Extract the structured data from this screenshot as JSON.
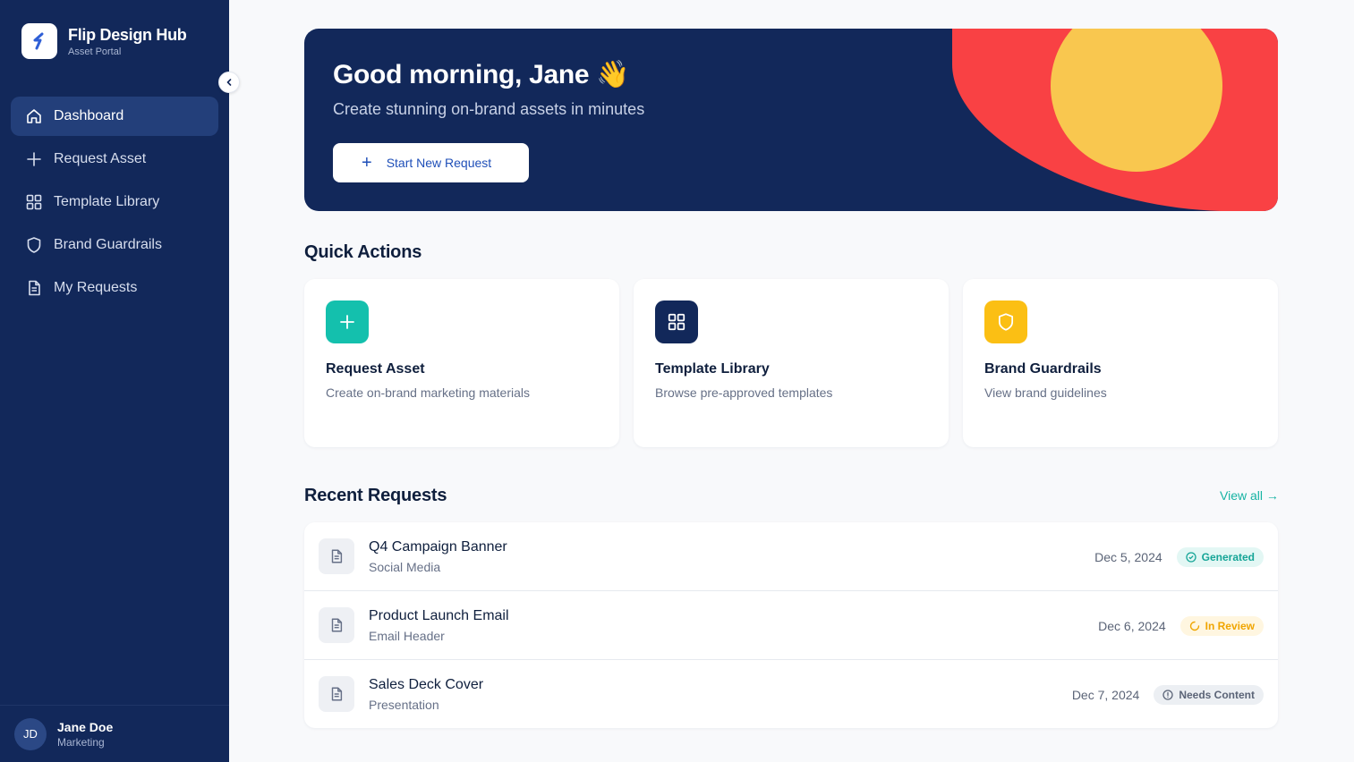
{
  "sidebar": {
    "brand_name": "Flip Design Hub",
    "brand_sub": "Asset Portal",
    "items": [
      {
        "label": "Dashboard",
        "icon": "home-icon",
        "active": true
      },
      {
        "label": "Request Asset",
        "icon": "plus-icon"
      },
      {
        "label": "Template Library",
        "icon": "grid-icon"
      },
      {
        "label": "Brand Guardrails",
        "icon": "shield-icon"
      },
      {
        "label": "My Requests",
        "icon": "document-icon"
      }
    ],
    "user": {
      "initials": "JD",
      "name": "Jane Doe",
      "role": "Marketing"
    }
  },
  "hero": {
    "title": "Good morning, Jane 👋",
    "subtitle": "Create stunning on-brand assets in minutes",
    "button_label": "Start New Request"
  },
  "quick_actions": {
    "title": "Quick Actions",
    "cards": [
      {
        "name": "Request Asset",
        "desc": "Create on-brand marketing materials",
        "icon": "plus-icon",
        "color": "#14c0ad"
      },
      {
        "name": "Template Library",
        "desc": "Browse pre-approved templates",
        "icon": "grid-icon",
        "color": "#12285a"
      },
      {
        "name": "Brand Guardrails",
        "desc": "View brand guidelines",
        "icon": "shield-icon",
        "color": "#fbbf14"
      }
    ]
  },
  "recent": {
    "title": "Recent Requests",
    "view_all": "View all →",
    "items": [
      {
        "title": "Q4 Campaign Banner",
        "type": "Social Media",
        "date": "Dec 5, 2024",
        "status": "Generated"
      },
      {
        "title": "Product Launch Email",
        "type": "Email Header",
        "date": "Dec 6, 2024",
        "status": "In Review"
      },
      {
        "title": "Sales Deck Cover",
        "type": "Presentation",
        "date": "Dec 7, 2024",
        "status": "Needs Content"
      }
    ]
  },
  "colors": {
    "navy": "#12285a",
    "teal": "#14c0ad",
    "yellow": "#fbbf14",
    "coral": "#f94144",
    "sun": "#f9c74f"
  }
}
